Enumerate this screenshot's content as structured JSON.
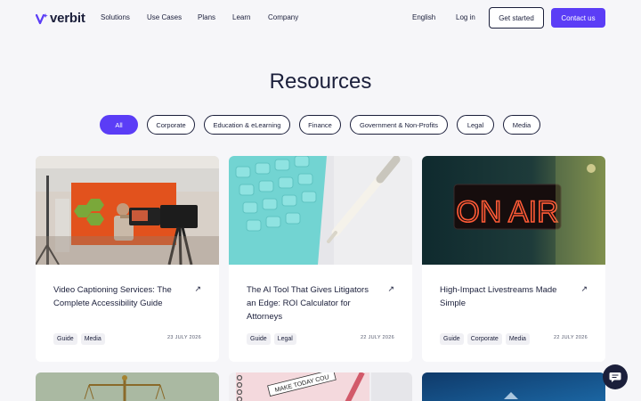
{
  "header": {
    "logo_text": "verbit",
    "nav": [
      "Solutions",
      "Use Cases",
      "Plans",
      "Learn",
      "Company"
    ],
    "language": "English",
    "login": "Log in",
    "get_started": "Get started",
    "contact": "Contact us"
  },
  "page": {
    "title": "Resources"
  },
  "filters": [
    "All",
    "Corporate",
    "Education & eLearning",
    "Finance",
    "Government & Non-Profits",
    "Legal",
    "Media"
  ],
  "cards": [
    {
      "title": "Video Captioning Services: The Complete Accessibility Guide",
      "tags": [
        "Guide",
        "Media"
      ],
      "date": "23 JULY 2026",
      "image": "video-studio-image"
    },
    {
      "title": "The AI Tool That Gives Litigators an Edge: ROI Calculator for Attorneys",
      "tags": [
        "Guide",
        "Legal"
      ],
      "date": "22 JULY 2026",
      "image": "calculator-pen-image"
    },
    {
      "title": "High-Impact Livestreams Made Simple",
      "tags": [
        "Guide",
        "Corporate",
        "Media"
      ],
      "date": "22 JULY 2026",
      "image": "on-air-sign-image",
      "sign_text": "ON AIR"
    }
  ],
  "second_row_card_2": {
    "sticky_note_text": "MAKE TODAY COU"
  },
  "colors": {
    "brand": "#5b3df6",
    "text": "#1b1f3b",
    "background": "#f6f6f9"
  },
  "icons": {
    "arrow": "↗",
    "chat": "chat-icon"
  }
}
